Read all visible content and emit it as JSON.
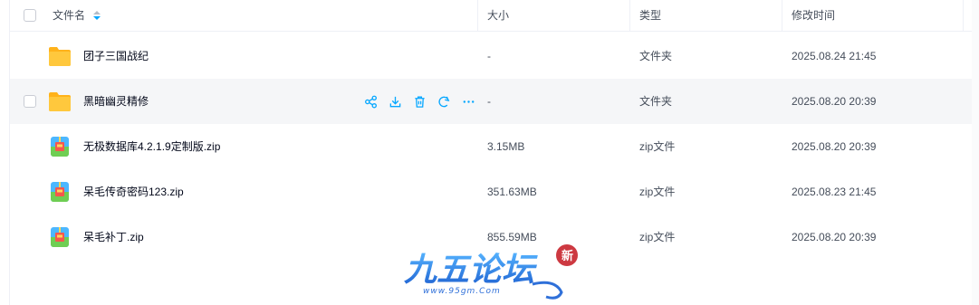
{
  "header": {
    "name_label": "文件名",
    "size_label": "大小",
    "type_label": "类型",
    "mtime_label": "修改时间"
  },
  "rows": [
    {
      "name": "团子三国战纪",
      "size": "-",
      "type": "文件夹",
      "mtime": "2025.08.24 21:45",
      "icon": "folder-icon",
      "hovered": false
    },
    {
      "name": "黑暗幽灵精修",
      "size": "-",
      "type": "文件夹",
      "mtime": "2025.08.20 20:39",
      "icon": "folder-icon",
      "hovered": true
    },
    {
      "name": "无极数据库4.2.1.9定制版.zip",
      "size": "3.15MB",
      "type": "zip文件",
      "mtime": "2025.08.20 20:39",
      "icon": "zip-file-icon",
      "hovered": false
    },
    {
      "name": "呆毛传奇密码123.zip",
      "size": "351.63MB",
      "type": "zip文件",
      "mtime": "2025.08.23 21:45",
      "icon": "zip-file-icon",
      "hovered": false
    },
    {
      "name": "呆毛补丁.zip",
      "size": "855.59MB",
      "type": "zip文件",
      "mtime": "2025.08.20 20:39",
      "icon": "zip-file-icon",
      "hovered": false
    }
  ],
  "row_actions": [
    "share-icon",
    "download-icon",
    "delete-icon",
    "sync-icon",
    "more-icon"
  ],
  "watermark": {
    "logo_text": "九五论坛",
    "badge_text": "新",
    "url": "www.95gm.Com"
  },
  "colors": {
    "accent": "#06a7ff",
    "folder": "#ffc437",
    "hover_bg": "#f5f6f8",
    "text": "#03081a",
    "muted": "#454d5a",
    "border": "#eef0f6"
  }
}
